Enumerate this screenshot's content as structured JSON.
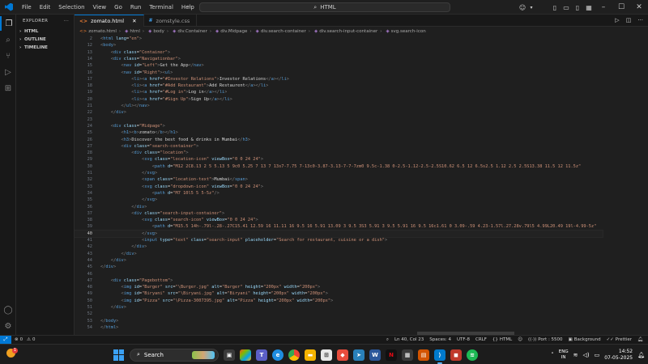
{
  "menu": [
    "File",
    "Edit",
    "Selection",
    "View",
    "Go",
    "Run",
    "Terminal",
    "Help"
  ],
  "search": {
    "text": "HTML"
  },
  "sidebar": {
    "title": "EXPLORER",
    "sections": [
      "HTML",
      "OUTLINE",
      "TIMELINE"
    ]
  },
  "tabs": [
    {
      "label": "zomato.html",
      "type": "html",
      "active": true
    },
    {
      "label": "zomstyle.css",
      "type": "css",
      "active": false
    }
  ],
  "breadcrumb": [
    "zomato.html",
    "html",
    "body",
    "div.Container",
    "div.Midpage",
    "div.search-container",
    "div.search-input-container",
    "svg.search-icon"
  ],
  "code_lines": [
    {
      "n": "2",
      "html": "<span class='br'>&lt;</span><span class='tag'>html</span> <span class='attr'>lang</span>=<span class='str'>\"en\"</span><span class='br'>&gt;</span>"
    },
    {
      "n": "12",
      "html": "<span class='br'>&lt;</span><span class='tag'>body</span><span class='br'>&gt;</span>"
    },
    {
      "n": "13",
      "html": "    <span class='br'>&lt;</span><span class='tag'>div</span> <span class='attr'>class</span>=<span class='str'>\"Container\"</span><span class='br'>&gt;</span>"
    },
    {
      "n": "14",
      "html": "    <span class='br'>&lt;</span><span class='tag'>div</span> <span class='attr'>class</span>=<span class='str'>\"Navigationbar\"</span><span class='br'>&gt;</span>"
    },
    {
      "n": "15",
      "html": "        <span class='br'>&lt;</span><span class='tag'>nav</span> <span class='attr'>id</span>=<span class='str'>\"Left\"</span><span class='br'>&gt;</span><span class='txt'>Get the App</span><span class='br'>&lt;/</span><span class='tag'>nav</span><span class='br'>&gt;</span>"
    },
    {
      "n": "16",
      "html": "        <span class='br'>&lt;</span><span class='tag'>nav</span> <span class='attr'>id</span>=<span class='str'>\"Right\"</span><span class='br'>&gt;&lt;</span><span class='tag'>ul</span><span class='br'>&gt;</span>"
    },
    {
      "n": "17",
      "html": "            <span class='br'>&lt;</span><span class='tag'>li</span><span class='br'>&gt;&lt;</span><span class='tag'>a</span> <span class='attr'>href</span>=<span class='str'>\"#Investor Relations\"</span><span class='br'>&gt;</span><span class='txt'>Investor Relations</span><span class='br'>&lt;/</span><span class='tag'>a</span><span class='br'>&gt;&lt;/</span><span class='tag'>li</span><span class='br'>&gt;</span>"
    },
    {
      "n": "18",
      "html": "            <span class='br'>&lt;</span><span class='tag'>li</span><span class='br'>&gt;&lt;</span><span class='tag'>a</span> <span class='attr'>href</span>=<span class='str'>\"#Add Restaurant\"</span><span class='br'>&gt;</span><span class='txt'>Add Restaurent</span><span class='br'>&lt;/</span><span class='tag'>a</span><span class='br'>&gt;&lt;/</span><span class='tag'>li</span><span class='br'>&gt;</span>"
    },
    {
      "n": "19",
      "html": "            <span class='br'>&lt;</span><span class='tag'>li</span><span class='br'>&gt;&lt;</span><span class='tag'>a</span> <span class='attr'>href</span>=<span class='str'>\"#Log in\"</span><span class='br'>&gt;</span><span class='txt'>Log in</span><span class='br'>&lt;/</span><span class='tag'>a</span><span class='br'>&gt;&lt;/</span><span class='tag'>li</span><span class='br'>&gt;</span>"
    },
    {
      "n": "20",
      "html": "            <span class='br'>&lt;</span><span class='tag'>li</span><span class='br'>&gt;&lt;</span><span class='tag'>a</span> <span class='attr'>href</span>=<span class='str'>\"#Sign Up\"</span><span class='br'>&gt;</span><span class='txt'>Sign Up</span><span class='br'>&lt;/</span><span class='tag'>a</span><span class='br'>&gt;&lt;/</span><span class='tag'>li</span><span class='br'>&gt;</span>"
    },
    {
      "n": "21",
      "html": "        <span class='br'>&lt;/</span><span class='tag'>ul</span><span class='br'>&gt;&lt;/</span><span class='tag'>nav</span><span class='br'>&gt;</span>"
    },
    {
      "n": "22",
      "html": "    <span class='br'>&lt;/</span><span class='tag'>div</span><span class='br'>&gt;</span>"
    },
    {
      "n": "23",
      "html": ""
    },
    {
      "n": "24",
      "html": "    <span class='br'>&lt;</span><span class='tag'>div</span> <span class='attr'>class</span>=<span class='str'>\"Midpage\"</span><span class='br'>&gt;</span>"
    },
    {
      "n": "25",
      "html": "        <span class='br'>&lt;</span><span class='tag'>h1</span><span class='br'>&gt;&lt;</span><span class='tag'>b</span><span class='br'>&gt;</span><span class='txt'>zomato</span><span class='br'>&lt;/</span><span class='tag'>b</span><span class='br'>&gt;&lt;/</span><span class='tag'>h1</span><span class='br'>&gt;</span>"
    },
    {
      "n": "26",
      "html": "        <span class='br'>&lt;</span><span class='tag'>h3</span><span class='br'>&gt;</span><span class='txt'>Discover the best food &amp; drinks in Mumbai</span><span class='br'>&lt;/</span><span class='tag'>h3</span><span class='br'>&gt;</span>"
    },
    {
      "n": "27",
      "html": "        <span class='br'>&lt;</span><span class='tag'>div</span> <span class='attr'>class</span>=<span class='str'>\"search-container\"</span><span class='br'>&gt;</span>"
    },
    {
      "n": "28",
      "html": "            <span class='br'>&lt;</span><span class='tag'>div</span> <span class='attr'>class</span>=<span class='str'>\"location\"</span><span class='br'>&gt;</span>"
    },
    {
      "n": "29",
      "html": "                <span class='br'>&lt;</span><span class='tag'>svg</span> <span class='attr'>class</span>=<span class='str'>\"location-icon\"</span> <span class='attr'>viewBox</span>=<span class='str'>\"0 0 24 24\"</span><span class='br'>&gt;</span>"
    },
    {
      "n": "30",
      "html": "                    <span class='br'>&lt;</span><span class='tag'>path</span> <span class='attr'>d</span>=<span class='str'>\"M12 2C8.13 2 5 5.13 5 9c0 5.25 7 13 7 13s7-7.75 7-13c0-3.87-3.13-7-7-7zm0 9.5c-1.38 0-2.5-1.12-2.5-2.5S10.62 6.5 12 6.5s2.5 1.12 2.5 2.5S13.38 11.5 12 11.5z\"</span>"
    },
    {
      "n": "31",
      "html": "                <span class='br'>&lt;/</span><span class='tag'>svg</span><span class='br'>&gt;</span>"
    },
    {
      "n": "32",
      "html": "                <span class='br'>&lt;</span><span class='tag'>span</span> <span class='attr'>class</span>=<span class='str'>\"location-text\"</span><span class='br'>&gt;</span><span class='txt'>Mumbai</span><span class='br'>&lt;/</span><span class='tag'>span</span><span class='br'>&gt;</span>"
    },
    {
      "n": "33",
      "html": "                <span class='br'>&lt;</span><span class='tag'>svg</span> <span class='attr'>class</span>=<span class='str'>\"dropdown-icon\"</span> <span class='attr'>viewBox</span>=<span class='str'>\"0 0 24 24\"</span><span class='br'>&gt;</span>"
    },
    {
      "n": "34",
      "html": "                    <span class='br'>&lt;</span><span class='tag'>path</span> <span class='attr'>d</span>=<span class='str'>\"M7 10l5 5 5-5z\"</span><span class='br'>/&gt;</span>"
    },
    {
      "n": "35",
      "html": "                <span class='br'>&lt;/</span><span class='tag'>svg</span><span class='br'>&gt;</span>"
    },
    {
      "n": "36",
      "html": "            <span class='br'>&lt;/</span><span class='tag'>div</span><span class='br'>&gt;</span>"
    },
    {
      "n": "37",
      "html": "            <span class='br'>&lt;</span><span class='tag'>div</span> <span class='attr'>class</span>=<span class='str'>\"search-input-container\"</span><span class='br'>&gt;</span>"
    },
    {
      "n": "38",
      "html": "                <span class='br'>&lt;</span><span class='tag'>svg</span> <span class='attr'>class</span>=<span class='str'>\"search-icon\"</span> <span class='attr'>viewBox</span>=<span class='str'>\"0 0 24 24\"</span><span class='br'>&gt;</span>"
    },
    {
      "n": "39",
      "html": "                    <span class='br'>&lt;</span><span class='tag'>path</span> <span class='attr'>d</span>=<span class='str'>\"M15.5 14h-.79l-.28-.27C15.41 12.59 16 11.11 16 9.5 16 5.91 13.09 3 9.5 3S3 5.91 3 9.5 5.91 16 9.5 16c1.61 0 3.09-.59 4.23-1.57l.27.28v.79l5 4.99L20.49 19l-4.99-5z\"</span>"
    },
    {
      "n": "40",
      "html": "                <span class='br'>&lt;/</span><span class='tag'>svg</span><span class='br'>&gt;</span>",
      "current": true
    },
    {
      "n": "41",
      "html": "                <span class='br'>&lt;</span><span class='tag'>input</span> <span class='attr'>type</span>=<span class='str'>\"text\"</span> <span class='attr'>class</span>=<span class='str'>\"search-input\"</span> <span class='attr'>placeholder</span>=<span class='str'>\"Search for restaurant, cuisine or a dish\"</span><span class='br'>&gt;</span>"
    },
    {
      "n": "42",
      "html": "            <span class='br'>&lt;/</span><span class='tag'>div</span><span class='br'>&gt;</span>"
    },
    {
      "n": "43",
      "html": "        <span class='br'>&lt;/</span><span class='tag'>div</span><span class='br'>&gt;</span>"
    },
    {
      "n": "44",
      "html": "    <span class='br'>&lt;/</span><span class='tag'>div</span><span class='br'>&gt;</span>"
    },
    {
      "n": "45",
      "html": "<span class='br'>&lt;/</span><span class='tag'>div</span><span class='br'>&gt;</span>"
    },
    {
      "n": "46",
      "html": ""
    },
    {
      "n": "47",
      "html": "    <span class='br'>&lt;</span><span class='tag'>div</span> <span class='attr'>class</span>=<span class='str'>\"Pagebottom\"</span><span class='br'>&gt;</span>"
    },
    {
      "n": "48",
      "html": "        <span class='br'>&lt;</span><span class='tag'>img</span> <span class='attr'>id</span>=<span class='str'>\"Burger\"</span> <span class='attr'>src</span>=<span class='str'>\"\\Burger.jpg\"</span> <span class='attr'>alt</span>=<span class='str'>\"Burger\"</span> <span class='attr'>height</span>=<span class='str'>\"200px\"</span> <span class='attr'>width</span>=<span class='str'>\"200px\"</span><span class='br'>&gt;</span>"
    },
    {
      "n": "49",
      "html": "        <span class='br'>&lt;</span><span class='tag'>img</span> <span class='attr'>id</span>=<span class='str'>\"Biryani\"</span> <span class='attr'>src</span>=<span class='str'>\"\\Biryani.jpg\"</span> <span class='attr'>alt</span>=<span class='str'>\"Biryani\"</span> <span class='attr'>height</span>=<span class='str'>\"200px\"</span> <span class='attr'>width</span>=<span class='str'>\"200px\"</span><span class='br'>&gt;</span>"
    },
    {
      "n": "50",
      "html": "        <span class='br'>&lt;</span><span class='tag'>img</span> <span class='attr'>id</span>=<span class='str'>\"Pizza\"</span> <span class='attr'>src</span>=<span class='str'>\"\\Pizza-3007395.jpg\"</span> <span class='attr'>alt</span>=<span class='str'>\"Pizza\"</span> <span class='attr'>height</span>=<span class='str'>\"200px\"</span> <span class='attr'>width</span>=<span class='str'>\"200px\"</span><span class='br'>&gt;</span>"
    },
    {
      "n": "51",
      "html": "    <span class='br'>&lt;/</span><span class='tag'>div</span><span class='br'>&gt;</span>"
    },
    {
      "n": "52",
      "html": ""
    },
    {
      "n": "53",
      "html": "<span class='br'>&lt;/</span><span class='tag'>body</span><span class='br'>&gt;</span>"
    },
    {
      "n": "54",
      "html": "<span class='br'>&lt;/</span><span class='tag'>html</span><span class='br'>&gt;</span>"
    }
  ],
  "status": {
    "errors": "0",
    "warnings": "0",
    "position": "Ln 40, Col 23",
    "spaces": "Spaces: 4",
    "encoding": "UTF-8",
    "eol": "CRLF",
    "language": "HTML",
    "port": "Port : 5500",
    "background": "Background",
    "prettier": "Prettier"
  },
  "taskbar": {
    "weather_badge": "1",
    "search_label": "Search",
    "lang_top": "ENG",
    "lang_bottom": "IN",
    "time": "14:52",
    "date": "07-05-2025"
  },
  "colors": {
    "accent": "#0078d4",
    "html_icon": "#e37933",
    "css_icon": "#42a5f5"
  }
}
